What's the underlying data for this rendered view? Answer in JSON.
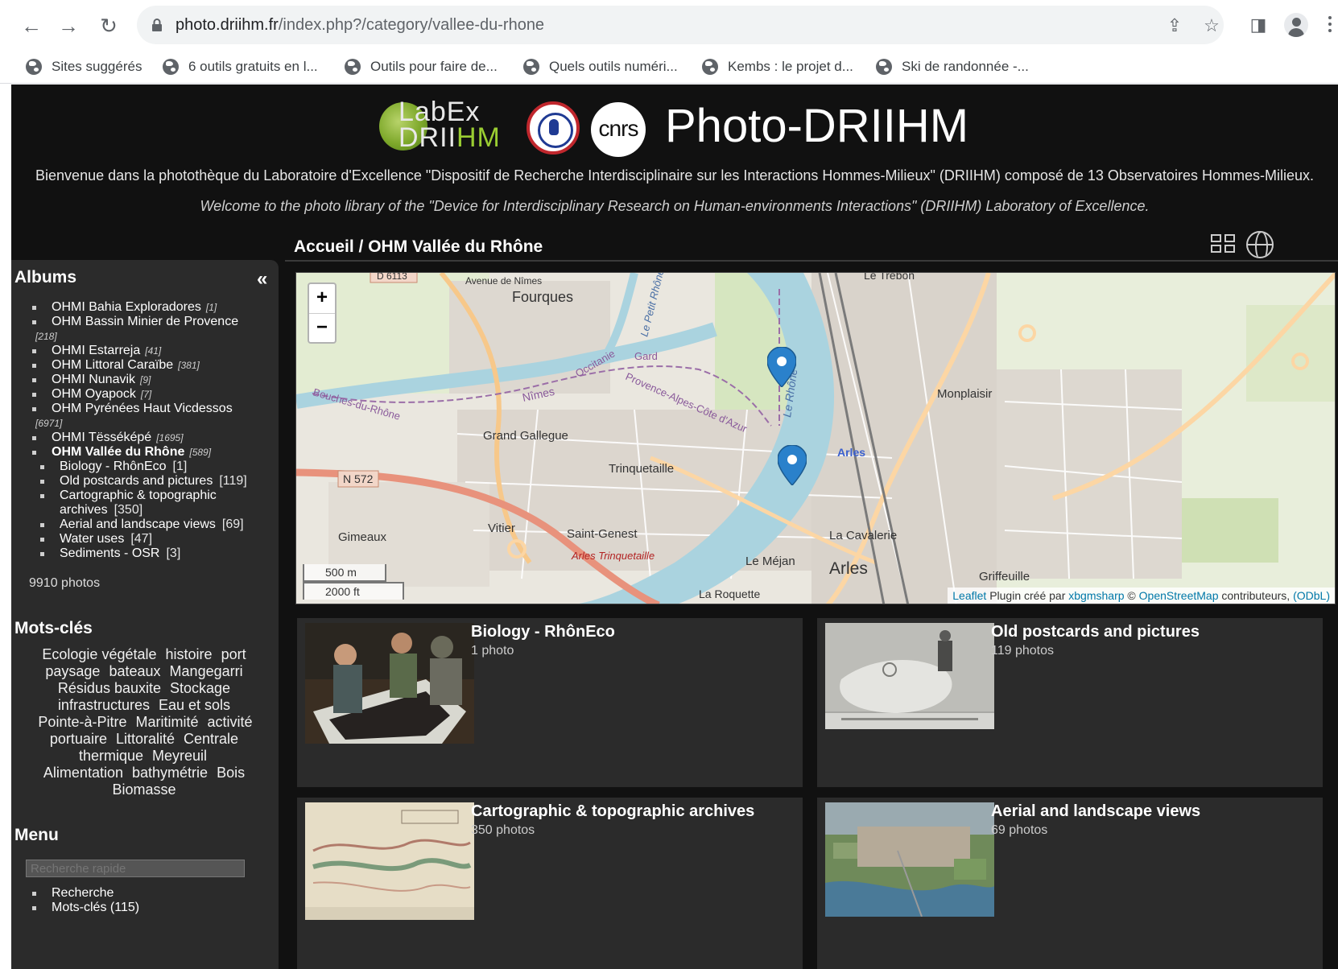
{
  "browser": {
    "url_host": "photo.driihm.fr",
    "url_path": "/index.php?/category/vallee-du-rhone",
    "bookmarks": [
      "Sites suggérés",
      "6 outils gratuits en l...",
      "Outils pour faire de...",
      "Quels outils numéri...",
      "Kembs : le projet d...",
      "Ski de randonnée -..."
    ]
  },
  "header": {
    "logo_labex_line1": "LabEx",
    "logo_labex_line2a": "DRII",
    "logo_labex_line2b": "HM",
    "logo_cnrs": "cnrs",
    "title": "Photo-DRIIHM",
    "welcome_fr": "Bienvenue dans la photothèque du Laboratoire d'Excellence \"Dispositif de Recherche Interdisciplinaire sur les Interactions Hommes-Milieux\" (DRIIHM) composé de 13 Observatoires Hommes-Milieux.",
    "welcome_en": "Welcome to the photo library of the \"Device for Interdisciplinary Research on Human-environments Interactions\" (DRIIHM) Laboratory of Excellence."
  },
  "sidebar": {
    "albums_title": "Albums",
    "collapse_glyph": "«",
    "albums": [
      {
        "label": "OHMI Bahia Exploradores",
        "count": "[1]"
      },
      {
        "label": "OHM Bassin Minier de Provence",
        "count": "[218]"
      },
      {
        "label": "OHMI Estarreja",
        "count": "[41]"
      },
      {
        "label": "OHM Littoral Caraïbe",
        "count": "[381]"
      },
      {
        "label": "OHMI Nunavik",
        "count": "[9]"
      },
      {
        "label": "OHM Oyapock",
        "count": "[7]"
      },
      {
        "label": "OHM Pyrénées Haut Vicdessos",
        "count": "[6971]"
      },
      {
        "label": "OHMI Tësséképé",
        "count": "[1695]"
      },
      {
        "label": "OHM Vallée du Rhône",
        "count": "[589]"
      }
    ],
    "subalbums": [
      {
        "label": "Biology - RhônEco",
        "count": "[1]"
      },
      {
        "label": "Old postcards and pictures",
        "count": "[119]"
      },
      {
        "label": "Cartographic & topographic archives",
        "count": "[350]"
      },
      {
        "label": "Aerial and landscape views",
        "count": "[69]"
      },
      {
        "label": "Water uses",
        "count": "[47]"
      },
      {
        "label": "Sediments - OSR",
        "count": "[3]"
      }
    ],
    "total": "9910 photos",
    "tags_title": "Mots-clés",
    "tags": [
      "Ecologie végétale",
      "histoire",
      "port",
      "paysage",
      "bateaux",
      "Mangegarri",
      "Résidus bauxite",
      "Stockage",
      "infrastructures",
      "Eau et sols",
      "Pointe-à-Pitre",
      "Maritimité",
      "activité portuaire",
      "Littoralité",
      "Centrale thermique",
      "Meyreuil",
      "Alimentation",
      "bathymétrie",
      "Bois",
      "Biomasse"
    ],
    "menu_title": "Menu",
    "search_placeholder": "Recherche rapide",
    "menu_items": [
      "Recherche",
      "Mots-clés (115)"
    ]
  },
  "main": {
    "breadcrumb": "Accueil / OHM Vallée du Rhône",
    "map": {
      "zoom_in": "+",
      "zoom_out": "−",
      "scale_m": "500 m",
      "scale_ft": "2000 ft",
      "attrib_leaflet": "Leaflet",
      "attrib_mid": " Plugin créé par ",
      "attrib_author": "xbgmsharp",
      "attrib_copy": " © ",
      "attrib_osm": "OpenStreetMap",
      "attrib_end": " contributeurs, ",
      "attrib_odbl": "(ODbL)",
      "labels": {
        "fourques": "Fourques",
        "avenue": "Avenue de Nîmes",
        "le_trebon": "Le Trébon",
        "monplaisir": "Monplaisir",
        "grand_gallegue": "Grand Gallegue",
        "trinquetaille": "Trinquetaille",
        "n572": "N 572",
        "gimeaux": "Gimeaux",
        "vitier": "Vitier",
        "saint_genest": "Saint-Genest",
        "arles_trinquetaille": "Arles Trinquetaille",
        "le_mejan": "Le Méjan",
        "arles": "Arles",
        "arles_small": "Arles",
        "la_cavalerie": "La Cavalerie",
        "griffeuille": "Griffeuille",
        "la_roquette": "La Roquette",
        "nimes": "Nîmes",
        "gard": "Gard",
        "occitanie": "Occitanie",
        "paca": "Provence-Alpes-Côte d'Azur",
        "bouches": "Bouches-du-Rhône",
        "le_rhone": "Le Rhône",
        "petit_rhone": "Le Petit Rhône",
        "d6113": "D 6113"
      }
    },
    "cards": [
      {
        "title": "Biology - RhônEco",
        "count": "1 photo"
      },
      {
        "title": "Old postcards and pictures",
        "count": "119 photos"
      },
      {
        "title": "Cartographic & topographic archives",
        "count": "350 photos"
      },
      {
        "title": "Aerial and landscape views",
        "count": "69 photos"
      }
    ]
  },
  "colors": {
    "page_bg": "#111111",
    "panel_bg": "#2b2b2b",
    "river": "#aad3df",
    "link": "#0078a8",
    "pin": "#2a81cb"
  }
}
